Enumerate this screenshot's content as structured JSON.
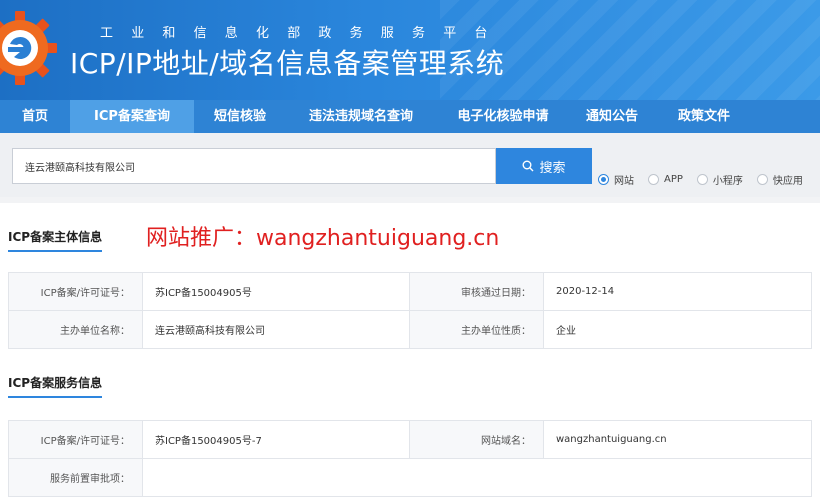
{
  "header": {
    "subtitle": "工业和信息化部政务服务平台",
    "title": "ICP/IP地址/域名信息备案管理系统"
  },
  "nav": {
    "items": [
      {
        "label": "首页",
        "active": false
      },
      {
        "label": "ICP备案查询",
        "active": true
      },
      {
        "label": "短信核验",
        "active": false
      },
      {
        "label": "违法违规域名查询",
        "active": false
      },
      {
        "label": "电子化核验申请",
        "active": false
      },
      {
        "label": "通知公告",
        "active": false
      },
      {
        "label": "政策文件",
        "active": false
      }
    ]
  },
  "search": {
    "value": "连云港颐高科技有限公司",
    "button_label": "搜索",
    "options": [
      {
        "label": "网站",
        "checked": true
      },
      {
        "label": "APP",
        "checked": false
      },
      {
        "label": "小程序",
        "checked": false
      },
      {
        "label": "快应用",
        "checked": false
      }
    ]
  },
  "watermark": "网站推广：wangzhantuiguang.cn",
  "subject": {
    "title": "ICP备案主体信息",
    "rows": [
      {
        "label1": "ICP备案/许可证号：",
        "value1": "苏ICP备15004905号",
        "label2": "审核通过日期：",
        "value2": "2020-12-14"
      },
      {
        "label1": "主办单位名称：",
        "value1": "连云港颐高科技有限公司",
        "label2": "主办单位性质：",
        "value2": "企业"
      }
    ]
  },
  "service": {
    "title": "ICP备案服务信息",
    "rows": [
      {
        "label1": "ICP备案/许可证号：",
        "value1": "苏ICP备15004905号-7",
        "label2": "网站域名：",
        "value2": "wangzhantuiguang.cn"
      },
      {
        "label1": "服务前置审批项：",
        "value1": "",
        "label2": "",
        "value2": ""
      }
    ]
  },
  "colors": {
    "header_blue": "#1d6fc4",
    "nav_blue": "#2e83d4",
    "nav_active": "#4fa0e6",
    "accent": "#2e86de",
    "watermark_red": "#e02020"
  }
}
